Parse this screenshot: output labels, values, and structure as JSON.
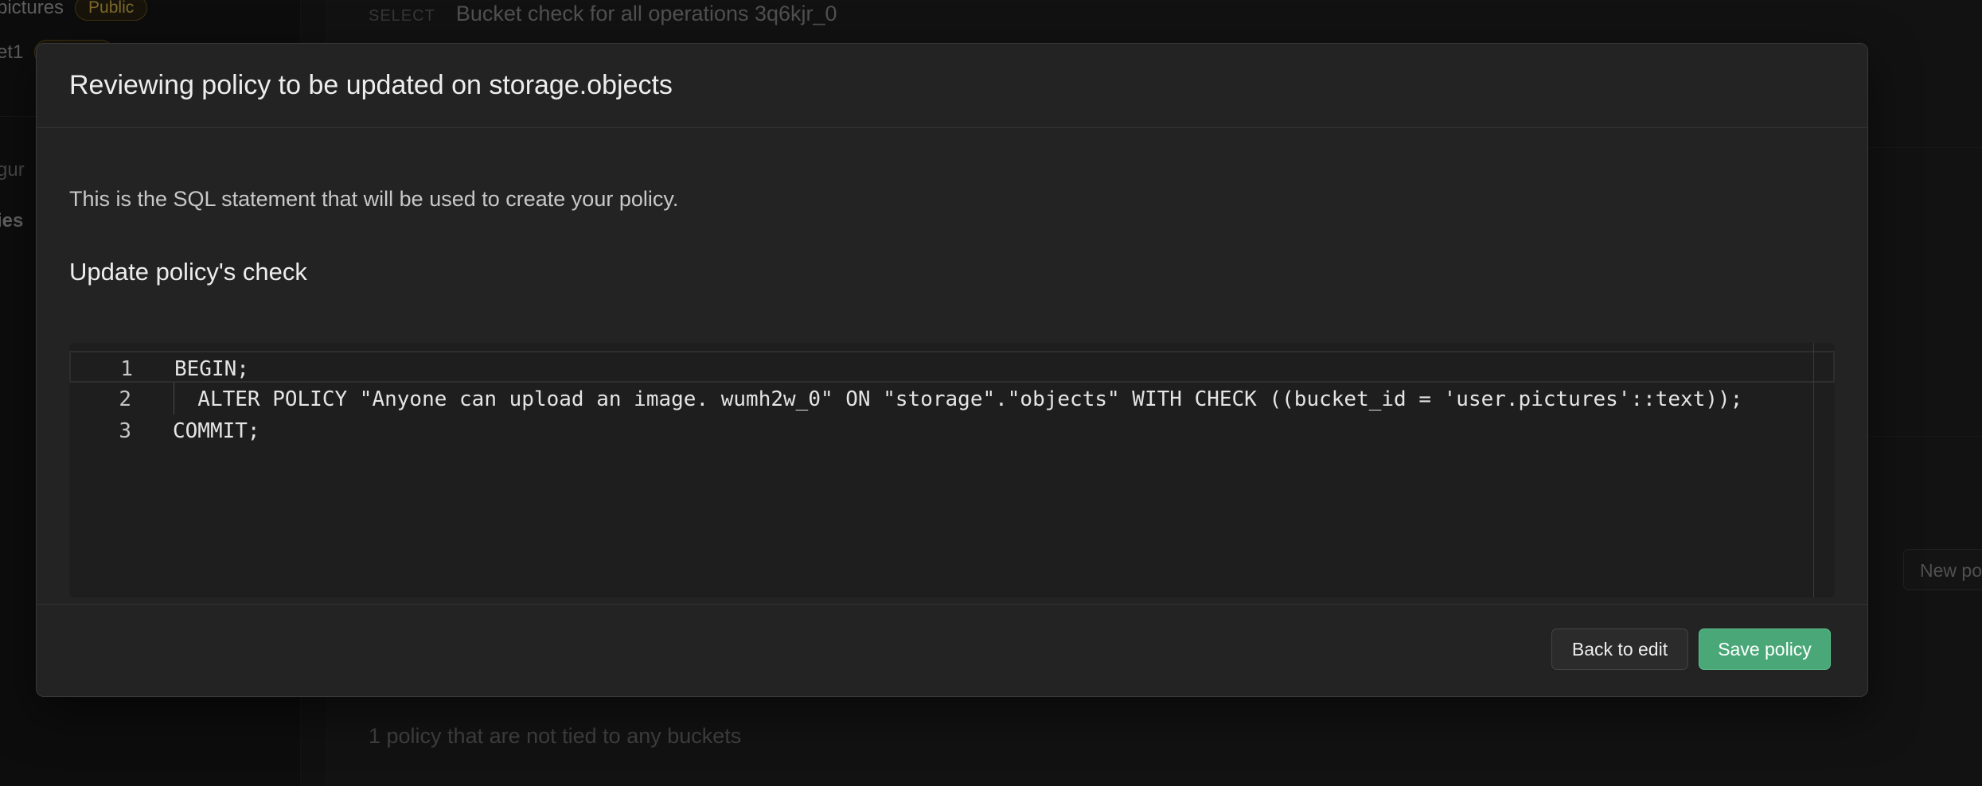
{
  "background": {
    "bucket_top": {
      "name": "pictures",
      "badge": "Public"
    },
    "bucket_second": {
      "name": "et1"
    },
    "sidebar_item_1": "gur",
    "sidebar_item_2": "ies",
    "select_tag": "SELECT",
    "select_policy_name": "Bucket check for all operations 3q6kjr_0",
    "new_policy_button": "New po",
    "untied_policies_text": "1 policy that are not tied to any buckets"
  },
  "modal": {
    "title": "Reviewing policy to be updated on storage.objects",
    "description": "This is the SQL statement that will be used to create your policy.",
    "section_title": "Update policy's check",
    "editor": {
      "lines": [
        {
          "number": "1",
          "code": "BEGIN;"
        },
        {
          "number": "2",
          "code": "  ALTER POLICY \"Anyone can upload an image. wumh2w_0\" ON \"storage\".\"objects\" WITH CHECK ((bucket_id = 'user.pictures'::text));"
        },
        {
          "number": "3",
          "code": "COMMIT;"
        }
      ]
    },
    "buttons": {
      "back_label": "Back to edit",
      "save_label": "Save policy"
    }
  },
  "colors": {
    "primary_button": "#4aa878",
    "modal_background": "#232323",
    "page_background": "#1c1c1c"
  }
}
